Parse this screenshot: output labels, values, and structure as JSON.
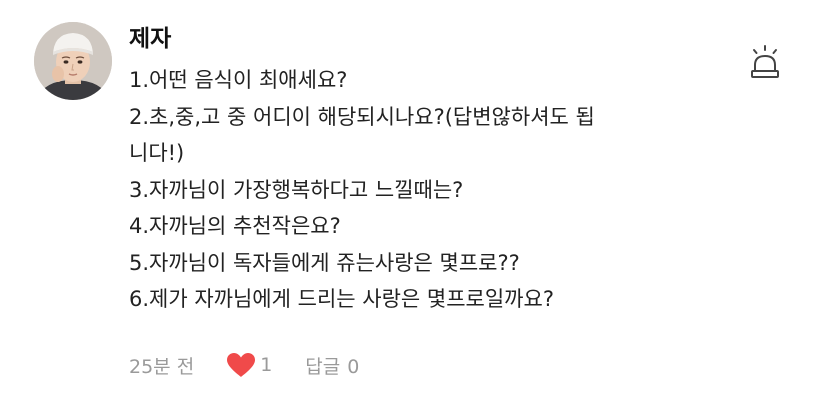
{
  "comment": {
    "author": "제자",
    "lines": [
      "1.어떤 음식이 최애세요?",
      "2.초,중,고 중 어디이 해당되시나요?(답변않하셔도 됩",
      "니다!)",
      "3.자까님이 가장행복하다고 느낄때는?",
      "4.자까님의 추천작은요?",
      "5.자까님이 독자들에게 쥬는사랑은 몇프로??",
      "6.제가 자까님에게 드리는 사랑은 몇프로일까요?"
    ],
    "time": "25분 전",
    "like_count": "1",
    "reply_label": "답글",
    "reply_count": "0"
  },
  "icons": {
    "report": "siren-icon",
    "like": "heart-icon",
    "avatar": "profile-photo"
  },
  "colors": {
    "heart": "#f04a4a",
    "meta_text": "#9a9a9a",
    "body_text": "#222222",
    "author_text": "#111111",
    "siren": "#444444"
  }
}
